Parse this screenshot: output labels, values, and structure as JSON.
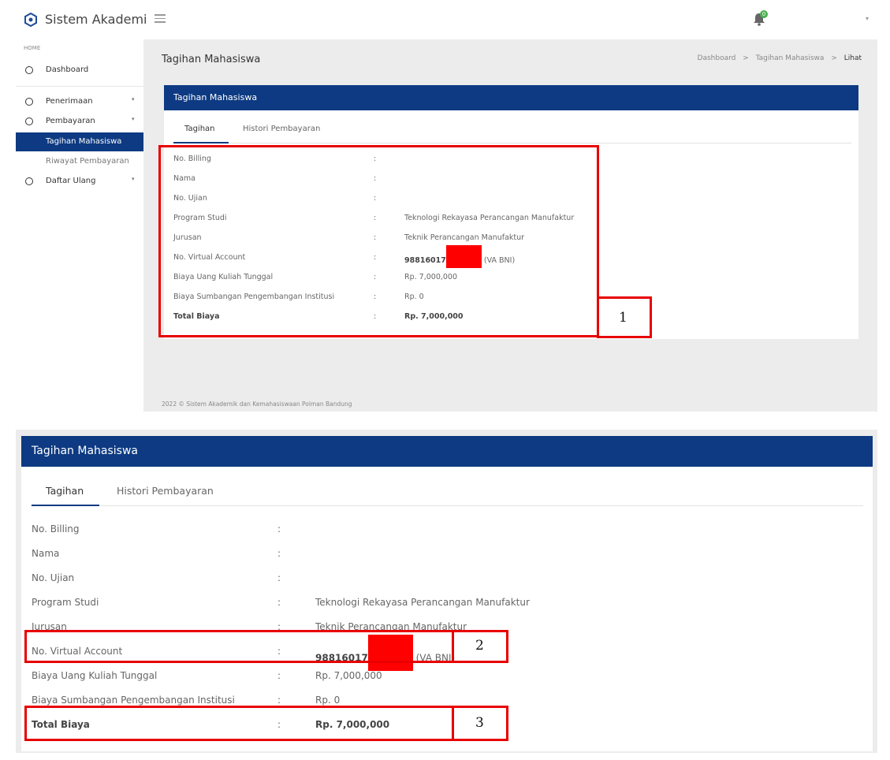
{
  "app": {
    "title": "Sistem Akademik"
  },
  "notifications": {
    "count": "0"
  },
  "sidebar": {
    "section": "HOME",
    "items": [
      {
        "label": "Dashboard"
      },
      {
        "label": "Penerimaan"
      },
      {
        "label": "Pembayaran"
      },
      {
        "label": "Tagihan Mahasiswa"
      },
      {
        "label": "Riwayat Pembayaran"
      },
      {
        "label": "Daftar Ulang"
      }
    ]
  },
  "page": {
    "title": "Tagihan Mahasiswa",
    "breadcrumb": [
      "Dashboard",
      "Tagihan Mahasiswa",
      "Lihat"
    ],
    "breadcrumb_sep": ">"
  },
  "card": {
    "title": "Tagihan Mahasiswa",
    "tabs": [
      "Tagihan",
      "Histori Pembayaran"
    ],
    "colon": ":",
    "rows": [
      {
        "label": "No. Billing",
        "value": ""
      },
      {
        "label": "Nama",
        "value": ""
      },
      {
        "label": "No. Ujian",
        "value": ""
      },
      {
        "label": "Program Studi",
        "value": "Teknologi Rekayasa Perancangan Manufaktur"
      },
      {
        "label": "Jurusan",
        "value": "Teknik Perancangan Manufaktur"
      },
      {
        "label": "No. Virtual Account",
        "value": "98816017",
        "suffix": "(VA BNI)"
      },
      {
        "label": "Biaya Uang Kuliah Tunggal",
        "value": "Rp. 7,000,000"
      },
      {
        "label": "Biaya Sumbangan Pengembangan Institusi",
        "value": "Rp. 0"
      },
      {
        "label": "Total Biaya",
        "value": "Rp. 7,000,000"
      }
    ]
  },
  "footer": "2022 © Sistem Akademik dan Kemahasiswaan Polman Bandung",
  "annotations": {
    "labels": [
      "1",
      "2",
      "3"
    ],
    "color": "#e80000"
  },
  "colors": {
    "primary": "#0d3a82",
    "redaction": "#ff0000",
    "content_bg": "#ececec"
  }
}
